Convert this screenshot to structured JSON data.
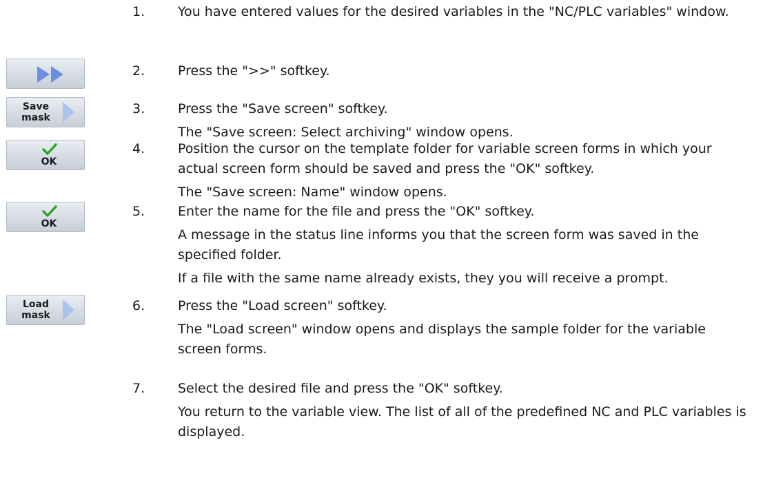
{
  "steps": [
    {
      "number": "1.",
      "lines": [
        "You have entered values for the desired variables in the \"NC/PLC variables\" window."
      ]
    },
    {
      "number": "2.",
      "lines": [
        "Press the \">>\" softkey."
      ]
    },
    {
      "number": "3.",
      "lines": [
        "Press the \"Save screen\" softkey.",
        "The \"Save screen: Select archiving\" window opens."
      ]
    },
    {
      "number": "4.",
      "lines": [
        "Position the cursor on the template folder for variable screen forms in which your actual screen form should be saved and press the \"OK\" softkey.",
        "The \"Save screen: Name\" window opens."
      ]
    },
    {
      "number": "5.",
      "lines": [
        "Enter the name for the file and press the \"OK\" softkey.",
        "A message in the status line informs you that the screen form was saved in the specified folder.",
        "If a file with the same name already exists, they you will receive a prompt."
      ]
    },
    {
      "number": "6.",
      "lines": [
        "Press the \"Load screen\" softkey.",
        "The \"Load screen\" window opens and displays the sample folder for the variable screen forms."
      ]
    },
    {
      "number": "7.",
      "lines": [
        "Select the desired file and press the \"OK\" softkey.",
        "You return to the variable view. The list of all of the predefined NC and PLC variables is displayed."
      ]
    }
  ],
  "softkeys": {
    "forward": {
      "icon": "double-arrow-right-icon"
    },
    "save_mask": {
      "line1": "Save",
      "line2": "mask",
      "icon": "arrow-right-icon"
    },
    "ok_1": {
      "label": "OK",
      "icon": "checkmark-icon"
    },
    "ok_2": {
      "label": "OK",
      "icon": "checkmark-icon"
    },
    "load_mask": {
      "line1": "Load",
      "line2": "mask",
      "icon": "arrow-right-icon"
    }
  },
  "colors": {
    "softkey_arrow": "#a9c3ec",
    "forward_arrow": "#6b8fdc",
    "checkmark": "#2aa52a"
  }
}
